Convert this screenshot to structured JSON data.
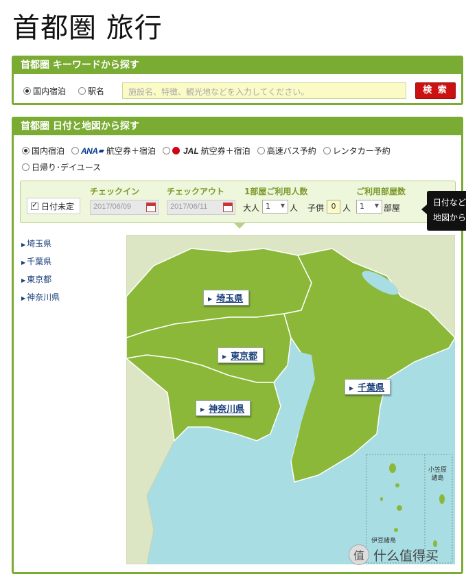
{
  "page": {
    "title": "首都圏 旅行"
  },
  "keyword_panel": {
    "header": "首都圏 キーワードから探す",
    "radio_domestic": "国内宿泊",
    "radio_station": "駅名",
    "search_placeholder": "施設名、特徴、観光地などを入力してください。",
    "search_button": "検 索"
  },
  "map_panel": {
    "header": "首都圏 日付と地図から探す",
    "modes": {
      "domestic": "国内宿泊",
      "ana_logo": "ANA",
      "ana_label": "航空券＋宿泊",
      "jal_logo": "JAL",
      "jal_label": "航空券＋宿泊",
      "bus": "高速バス予約",
      "rental": "レンタカー予約",
      "daytrip": "日帰り･デイユース"
    },
    "date": {
      "undecided": "日付未定",
      "checkin_label": "チェックイン",
      "checkin_value": "2017/06/09",
      "checkout_label": "チェックアウト",
      "checkout_value": "2017/06/11",
      "guests_label": "1部屋ご利用人数",
      "adult_label": "大人",
      "adult_value": "1",
      "person_unit": "人",
      "child_label": "子供",
      "child_value": "0",
      "child_unit": "人",
      "rooms_label": "ご利用部屋数",
      "rooms_value": "1",
      "rooms_unit": "部屋"
    },
    "tooltip": {
      "line1": "日付など",
      "line2": "地図から"
    },
    "prefectures": [
      "埼玉県",
      "千葉県",
      "東京都",
      "神奈川県"
    ],
    "map_labels": {
      "saitama": "埼玉県",
      "tokyo": "東京都",
      "chiba": "千葉県",
      "kanagawa": "神奈川県",
      "ogasawara_1": "小笠原",
      "ogasawara_2": "諸島",
      "izu": "伊豆諸島"
    }
  },
  "watermark": "什么值得买",
  "colors": {
    "green": "#7aab32",
    "land": "#8bb838",
    "sea": "#a7dde3",
    "other_land": "#dde6c4",
    "search_red": "#cc1111"
  }
}
